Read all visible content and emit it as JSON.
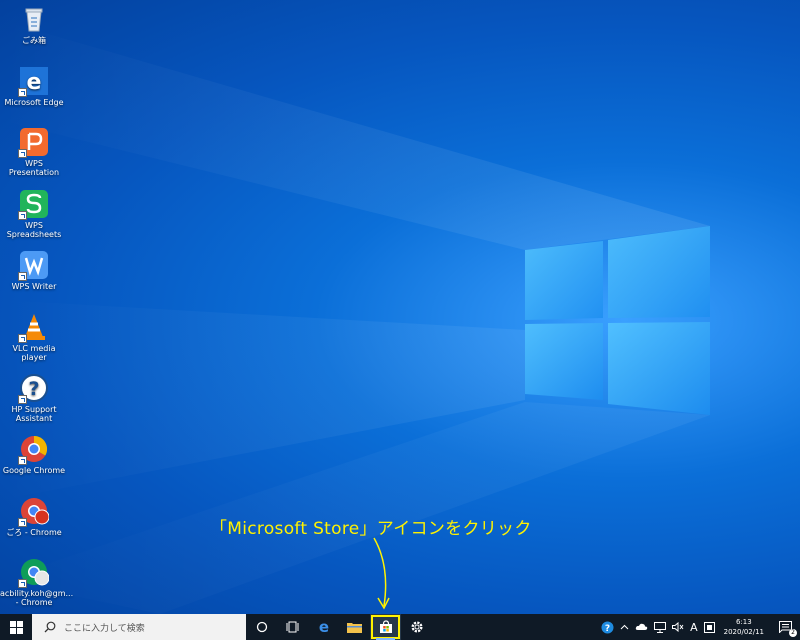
{
  "desktop": {
    "icons": [
      {
        "label": "ごみ箱",
        "icon": "recycle-bin-icon"
      },
      {
        "label": "Microsoft Edge",
        "icon": "edge-icon"
      },
      {
        "label": "WPS Presentation",
        "icon": "wps-presentation-icon"
      },
      {
        "label": "WPS Spreadsheets",
        "icon": "wps-spreadsheets-icon"
      },
      {
        "label": "WPS Writer",
        "icon": "wps-writer-icon"
      },
      {
        "label": "VLC media player",
        "icon": "vlc-icon"
      },
      {
        "label": "HP Support Assistant",
        "icon": "hp-support-icon"
      },
      {
        "label": "Google Chrome",
        "icon": "chrome-icon"
      },
      {
        "label": "ごろ - Chrome",
        "icon": "chrome-profile-icon"
      },
      {
        "label": "acbility.koh@gm... - Chrome",
        "icon": "chrome-profile-icon"
      }
    ]
  },
  "annotation": {
    "text": "「Microsoft Store」アイコンをクリック",
    "color": "#fff200"
  },
  "taskbar": {
    "search_placeholder": "ここに入力して検索",
    "pinned": [
      "cortana-icon",
      "task-view-icon",
      "edge-icon",
      "file-explorer-icon",
      "microsoft-store-icon",
      "settings-icon"
    ],
    "highlighted": "microsoft-store-icon",
    "tray": {
      "ime_label": "A",
      "time": "6:13",
      "date": "2020/02/11",
      "notification_count": "2"
    }
  }
}
